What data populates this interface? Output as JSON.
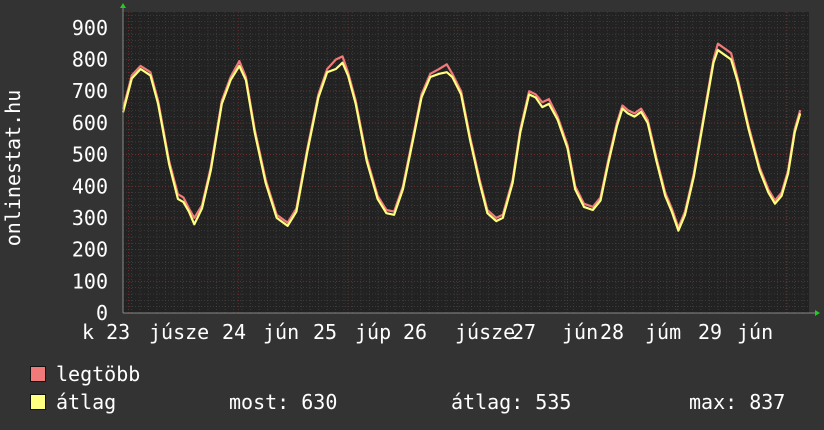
{
  "chart_data": {
    "type": "line",
    "ylabel": "onlinestat.hu",
    "ylim": [
      0,
      950
    ],
    "yticks": [
      0,
      100,
      200,
      300,
      400,
      500,
      600,
      700,
      800,
      900
    ],
    "grid": true,
    "xtick_labels": [
      "k 23",
      "júsze",
      "24",
      "jún",
      "25",
      "júp",
      "26",
      "júsze",
      "27",
      "jún",
      "28",
      "júm",
      "29",
      "jún"
    ],
    "series": [
      {
        "name": "legtöbb",
        "color": "#f07a7a",
        "points": [
          [
            0,
            0.643
          ],
          [
            0.08,
            0.75
          ],
          [
            0.16,
            0.78
          ],
          [
            0.25,
            0.76
          ],
          [
            0.32,
            0.67
          ],
          [
            0.42,
            0.48
          ],
          [
            0.5,
            0.375
          ],
          [
            0.55,
            0.365
          ],
          [
            0.6,
            0.33
          ],
          [
            0.65,
            0.3
          ],
          [
            0.72,
            0.34
          ],
          [
            0.8,
            0.46
          ],
          [
            0.9,
            0.67
          ],
          [
            0.98,
            0.745
          ],
          [
            1.06,
            0.795
          ],
          [
            1.12,
            0.745
          ],
          [
            1.2,
            0.58
          ],
          [
            1.3,
            0.42
          ],
          [
            1.4,
            0.31
          ],
          [
            1.5,
            0.285
          ],
          [
            1.58,
            0.33
          ],
          [
            1.68,
            0.52
          ],
          [
            1.78,
            0.69
          ],
          [
            1.86,
            0.77
          ],
          [
            1.94,
            0.8
          ],
          [
            2.0,
            0.81
          ],
          [
            2.05,
            0.76
          ],
          [
            2.12,
            0.67
          ],
          [
            2.22,
            0.49
          ],
          [
            2.32,
            0.37
          ],
          [
            2.4,
            0.325
          ],
          [
            2.47,
            0.32
          ],
          [
            2.55,
            0.4
          ],
          [
            2.65,
            0.57
          ],
          [
            2.72,
            0.69
          ],
          [
            2.8,
            0.755
          ],
          [
            2.88,
            0.77
          ],
          [
            2.95,
            0.785
          ],
          [
            3.0,
            0.755
          ],
          [
            3.08,
            0.7
          ],
          [
            3.16,
            0.56
          ],
          [
            3.25,
            0.42
          ],
          [
            3.32,
            0.325
          ],
          [
            3.4,
            0.3
          ],
          [
            3.46,
            0.31
          ],
          [
            3.55,
            0.42
          ],
          [
            3.62,
            0.58
          ],
          [
            3.7,
            0.7
          ],
          [
            3.76,
            0.69
          ],
          [
            3.82,
            0.665
          ],
          [
            3.88,
            0.675
          ],
          [
            3.96,
            0.62
          ],
          [
            4.05,
            0.53
          ],
          [
            4.12,
            0.4
          ],
          [
            4.2,
            0.345
          ],
          [
            4.28,
            0.335
          ],
          [
            4.35,
            0.365
          ],
          [
            4.42,
            0.48
          ],
          [
            4.5,
            0.6
          ],
          [
            4.55,
            0.655
          ],
          [
            4.6,
            0.64
          ],
          [
            4.66,
            0.63
          ],
          [
            4.72,
            0.645
          ],
          [
            4.78,
            0.61
          ],
          [
            4.86,
            0.49
          ],
          [
            4.94,
            0.38
          ],
          [
            5.0,
            0.33
          ],
          [
            5.06,
            0.27
          ],
          [
            5.12,
            0.32
          ],
          [
            5.2,
            0.44
          ],
          [
            5.3,
            0.64
          ],
          [
            5.38,
            0.8
          ],
          [
            5.42,
            0.85
          ],
          [
            5.48,
            0.835
          ],
          [
            5.54,
            0.82
          ],
          [
            5.6,
            0.74
          ],
          [
            5.7,
            0.59
          ],
          [
            5.8,
            0.46
          ],
          [
            5.88,
            0.39
          ],
          [
            5.94,
            0.355
          ],
          [
            6.0,
            0.38
          ],
          [
            6.06,
            0.45
          ],
          [
            6.12,
            0.58
          ],
          [
            6.17,
            0.64
          ]
        ]
      },
      {
        "name": "átlag",
        "color": "#ffff80",
        "points": [
          [
            0,
            0.633
          ],
          [
            0.08,
            0.74
          ],
          [
            0.16,
            0.77
          ],
          [
            0.25,
            0.75
          ],
          [
            0.32,
            0.66
          ],
          [
            0.42,
            0.47
          ],
          [
            0.5,
            0.36
          ],
          [
            0.55,
            0.35
          ],
          [
            0.6,
            0.32
          ],
          [
            0.65,
            0.28
          ],
          [
            0.72,
            0.33
          ],
          [
            0.8,
            0.45
          ],
          [
            0.9,
            0.66
          ],
          [
            0.98,
            0.735
          ],
          [
            1.06,
            0.78
          ],
          [
            1.12,
            0.735
          ],
          [
            1.2,
            0.57
          ],
          [
            1.3,
            0.41
          ],
          [
            1.4,
            0.3
          ],
          [
            1.5,
            0.275
          ],
          [
            1.58,
            0.32
          ],
          [
            1.68,
            0.51
          ],
          [
            1.78,
            0.68
          ],
          [
            1.86,
            0.76
          ],
          [
            1.94,
            0.77
          ],
          [
            2.0,
            0.79
          ],
          [
            2.05,
            0.75
          ],
          [
            2.12,
            0.66
          ],
          [
            2.22,
            0.48
          ],
          [
            2.32,
            0.36
          ],
          [
            2.4,
            0.315
          ],
          [
            2.47,
            0.31
          ],
          [
            2.55,
            0.39
          ],
          [
            2.65,
            0.56
          ],
          [
            2.72,
            0.68
          ],
          [
            2.8,
            0.745
          ],
          [
            2.88,
            0.755
          ],
          [
            2.95,
            0.76
          ],
          [
            3.0,
            0.745
          ],
          [
            3.08,
            0.69
          ],
          [
            3.16,
            0.55
          ],
          [
            3.25,
            0.41
          ],
          [
            3.32,
            0.315
          ],
          [
            3.4,
            0.29
          ],
          [
            3.46,
            0.3
          ],
          [
            3.55,
            0.41
          ],
          [
            3.62,
            0.57
          ],
          [
            3.7,
            0.69
          ],
          [
            3.76,
            0.68
          ],
          [
            3.82,
            0.65
          ],
          [
            3.88,
            0.66
          ],
          [
            3.96,
            0.61
          ],
          [
            4.05,
            0.52
          ],
          [
            4.12,
            0.39
          ],
          [
            4.2,
            0.335
          ],
          [
            4.28,
            0.325
          ],
          [
            4.35,
            0.355
          ],
          [
            4.42,
            0.47
          ],
          [
            4.5,
            0.59
          ],
          [
            4.55,
            0.645
          ],
          [
            4.6,
            0.63
          ],
          [
            4.66,
            0.62
          ],
          [
            4.72,
            0.635
          ],
          [
            4.78,
            0.6
          ],
          [
            4.86,
            0.48
          ],
          [
            4.94,
            0.37
          ],
          [
            5.0,
            0.32
          ],
          [
            5.06,
            0.26
          ],
          [
            5.12,
            0.31
          ],
          [
            5.2,
            0.43
          ],
          [
            5.3,
            0.63
          ],
          [
            5.38,
            0.79
          ],
          [
            5.42,
            0.83
          ],
          [
            5.48,
            0.815
          ],
          [
            5.54,
            0.8
          ],
          [
            5.6,
            0.73
          ],
          [
            5.7,
            0.58
          ],
          [
            5.8,
            0.45
          ],
          [
            5.88,
            0.38
          ],
          [
            5.94,
            0.345
          ],
          [
            6.0,
            0.37
          ],
          [
            6.06,
            0.44
          ],
          [
            6.12,
            0.57
          ],
          [
            6.17,
            0.63
          ]
        ]
      }
    ]
  },
  "legend": [
    {
      "label": "legtöbb",
      "color": "#f07a7a"
    },
    {
      "label": "átlag",
      "color": "#ffff80"
    }
  ],
  "stats": {
    "current": "most: 630",
    "average": "átlag: 535",
    "max": "max: 837"
  }
}
